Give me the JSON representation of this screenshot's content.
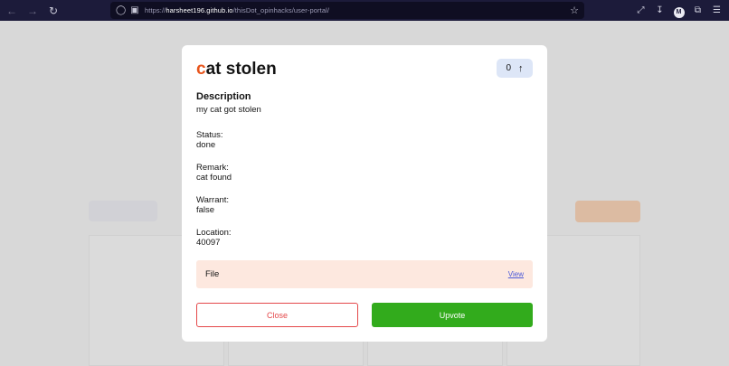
{
  "browser": {
    "url_scheme": "https://",
    "url_host": "harsheet196.github.io",
    "url_path": "/thisDot_opinhacks/user-portal/",
    "account_initial": "M"
  },
  "modal": {
    "title_initial": "c",
    "title_rest": "at stolen",
    "vote_count": "0",
    "description_label": "Description",
    "description_value": "my cat got stolen",
    "status_label": "Status:",
    "status_value": "done",
    "remark_label": "Remark:",
    "remark_value": "cat found",
    "warrant_label": "Warrant:",
    "warrant_value": "false",
    "location_label": "Location:",
    "location_value": "40097",
    "file_label": "File",
    "view_link": "View",
    "close_label": "Close",
    "upvote_label": "Upvote"
  },
  "colors": {
    "title_accent": "#e8551c",
    "upvote": "#32ab1c",
    "close": "#e4484a",
    "file_bg": "#fde8df",
    "vote_bg": "#dde6f7"
  }
}
